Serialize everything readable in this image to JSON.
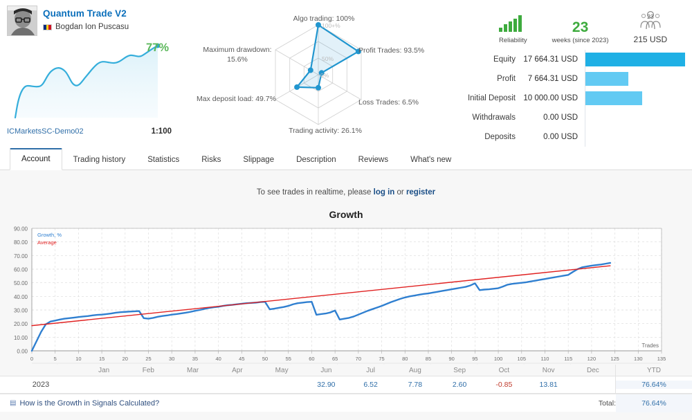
{
  "signal": {
    "name": "Quantum Trade V2",
    "author": "Bogdan Ion Puscasu",
    "flag_colors": [
      "#002B7F",
      "#FCD116",
      "#CE1126"
    ],
    "growth_badge": "77%",
    "broker": "ICMarketsSC-Demo02",
    "leverage": "1:100",
    "spark_color": "#35aedb"
  },
  "radar": {
    "inner_labels": [
      "100+%",
      "50%",
      "0%"
    ],
    "axes": [
      {
        "key": "algo_trading",
        "label": "Algo trading: 100%",
        "value": 100
      },
      {
        "key": "profit_trades",
        "label": "Profit Trades: 93.5%",
        "value": 93.5
      },
      {
        "key": "loss_trades",
        "label": "Loss Trades: 6.5%",
        "value": 6.5
      },
      {
        "key": "trading_activity",
        "label": "Trading activity: 26.1%",
        "value": 26.1
      },
      {
        "key": "max_deposit_load",
        "label": "Max deposit load: 49.7%",
        "value": 49.7
      },
      {
        "key": "max_drawdown",
        "label": "Maximum drawdown: 15.6%",
        "value": 15.6
      }
    ],
    "accent": "#2196cf"
  },
  "badges": {
    "reliability_caption": "Reliability",
    "reliability_color": "#3eab3e",
    "weeks_value": "23",
    "weeks_caption": "weeks (since 2023)",
    "subscribers_count": "23",
    "subscribers_price": "215 USD"
  },
  "bars": {
    "rows": [
      {
        "label": "Equity",
        "value": "17 664.31 USD",
        "pct": 100,
        "color": "#1fb0e5"
      },
      {
        "label": "Profit",
        "value": "7 664.31 USD",
        "pct": 43.4,
        "color": "#62caf3"
      },
      {
        "label": "Initial Deposit",
        "value": "10 000.00 USD",
        "pct": 56.6,
        "color": "#62caf3"
      },
      {
        "label": "Withdrawals",
        "value": "0.00 USD",
        "pct": 0,
        "color": "#62caf3"
      },
      {
        "label": "Deposits",
        "value": "0.00 USD",
        "pct": 0,
        "color": "#62caf3"
      }
    ]
  },
  "tabs": [
    {
      "label": "Account",
      "active": true
    },
    {
      "label": "Trading history",
      "active": false
    },
    {
      "label": "Statistics",
      "active": false
    },
    {
      "label": "Risks",
      "active": false
    },
    {
      "label": "Slippage",
      "active": false
    },
    {
      "label": "Description",
      "active": false
    },
    {
      "label": "Reviews",
      "active": false
    },
    {
      "label": "What's new",
      "active": false
    }
  ],
  "realtime": {
    "prefix": "To see trades in realtime, please ",
    "login": "log in",
    "middle": " or ",
    "register": "register"
  },
  "monthly": {
    "year": "2023",
    "months": [
      "Jan",
      "Feb",
      "Mar",
      "Apr",
      "May",
      "Jun",
      "Jul",
      "Aug",
      "Sep",
      "Oct",
      "Nov",
      "Dec"
    ],
    "values": [
      "",
      "",
      "",
      "",
      "",
      "32.90",
      "6.52",
      "7.78",
      "2.60",
      "-0.85",
      "13.81",
      ""
    ],
    "ytd_header": "YTD",
    "ytd_value": "76.64%",
    "total_label": "Total:",
    "total_value": "76.64%"
  },
  "footer": {
    "calc_link": "How is the Growth in Signals Calculated?"
  },
  "chart_data": {
    "type": "line",
    "title": "Growth",
    "xlabel": "Trades",
    "ylabel": "",
    "xlim": [
      0,
      135
    ],
    "ylim": [
      0,
      90
    ],
    "xticks": [
      0,
      5,
      10,
      15,
      20,
      25,
      30,
      35,
      40,
      45,
      50,
      55,
      60,
      65,
      70,
      75,
      80,
      85,
      90,
      95,
      100,
      105,
      110,
      115,
      120,
      125,
      130,
      135
    ],
    "yticks": [
      "0.00",
      "10.00",
      "20.00",
      "30.00",
      "40.00",
      "50.00",
      "60.00",
      "70.00",
      "80.00",
      "90.00"
    ],
    "grid": true,
    "legend": [
      "Growth, %",
      "Average"
    ],
    "legend_position": "top-left",
    "month_bands": [
      {
        "label": "Jan",
        "x": 11
      },
      {
        "label": "Feb",
        "x": 21
      },
      {
        "label": "Mar",
        "x": 31
      },
      {
        "label": "Apr",
        "x": 41
      },
      {
        "label": "May",
        "x": 51
      },
      {
        "label": "Jun",
        "x": 61
      },
      {
        "label": "Jul",
        "x": 71
      },
      {
        "label": "Aug",
        "x": 81
      },
      {
        "label": "Sep",
        "x": 91
      },
      {
        "label": "Oct",
        "x": 101
      },
      {
        "label": "Nov",
        "x": 111
      },
      {
        "label": "Dec",
        "x": 121
      }
    ],
    "series": [
      {
        "name": "Growth, %",
        "color": "#2f7fd0",
        "x": [
          0,
          1,
          2,
          3,
          4,
          5,
          6,
          7,
          8,
          9,
          10,
          11,
          12,
          13,
          14,
          15,
          16,
          17,
          18,
          19,
          20,
          21,
          22,
          23,
          24,
          25,
          26,
          27,
          28,
          29,
          30,
          31,
          32,
          33,
          34,
          35,
          36,
          37,
          38,
          39,
          40,
          41,
          42,
          43,
          44,
          45,
          46,
          47,
          48,
          49,
          50,
          51,
          52,
          53,
          54,
          55,
          56,
          57,
          58,
          59,
          60,
          61,
          62,
          63,
          64,
          65,
          66,
          67,
          68,
          69,
          70,
          71,
          72,
          73,
          74,
          75,
          76,
          77,
          78,
          79,
          80,
          81,
          82,
          83,
          84,
          85,
          86,
          87,
          88,
          89,
          90,
          91,
          92,
          93,
          94,
          95,
          96,
          97,
          98,
          99,
          100,
          101,
          102,
          103,
          104,
          105,
          106,
          107,
          108,
          109,
          110,
          111,
          112,
          113,
          114,
          115,
          116,
          117,
          118,
          119,
          120,
          121,
          122,
          123,
          124
        ],
        "y": [
          0,
          7,
          14,
          19.5,
          21.5,
          22.2,
          23.0,
          23.6,
          24.0,
          24.4,
          24.8,
          25.2,
          25.5,
          26.0,
          26.4,
          26.6,
          27.0,
          27.4,
          28.0,
          28.4,
          28.6,
          28.8,
          29.0,
          29.2,
          24.0,
          23.6,
          24.2,
          25.0,
          25.6,
          26.0,
          26.6,
          27.0,
          27.5,
          28.0,
          28.6,
          29.4,
          30.0,
          30.8,
          31.5,
          32.0,
          32.4,
          33.0,
          33.5,
          33.8,
          34.2,
          34.6,
          35.0,
          35.2,
          35.4,
          35.8,
          36.0,
          30.5,
          31.0,
          31.6,
          32.2,
          33.0,
          34.2,
          35.0,
          35.4,
          35.8,
          36.0,
          26.5,
          27.0,
          27.4,
          28.2,
          29.6,
          23.0,
          23.6,
          24.2,
          25.2,
          26.6,
          28.0,
          29.4,
          30.6,
          31.8,
          33.0,
          34.4,
          35.8,
          37.0,
          38.2,
          39.2,
          40.0,
          40.6,
          41.2,
          41.8,
          42.2,
          42.8,
          43.4,
          44.0,
          44.6,
          45.2,
          45.8,
          46.4,
          47.0,
          48.0,
          49.6,
          44.6,
          45.0,
          45.2,
          45.6,
          46.0,
          47.2,
          48.6,
          49.2,
          49.6,
          50.0,
          50.4,
          51.0,
          51.6,
          52.2,
          52.8,
          53.4,
          54.0,
          54.6,
          55.2,
          55.8,
          58.0,
          60.0,
          61.4,
          62.0,
          62.6,
          63.0,
          63.4,
          64.0,
          64.6,
          65.0
        ]
      },
      {
        "name": "Average",
        "color": "#e02020",
        "x": [
          0,
          124
        ],
        "y": [
          18.5,
          62.5
        ]
      }
    ]
  }
}
